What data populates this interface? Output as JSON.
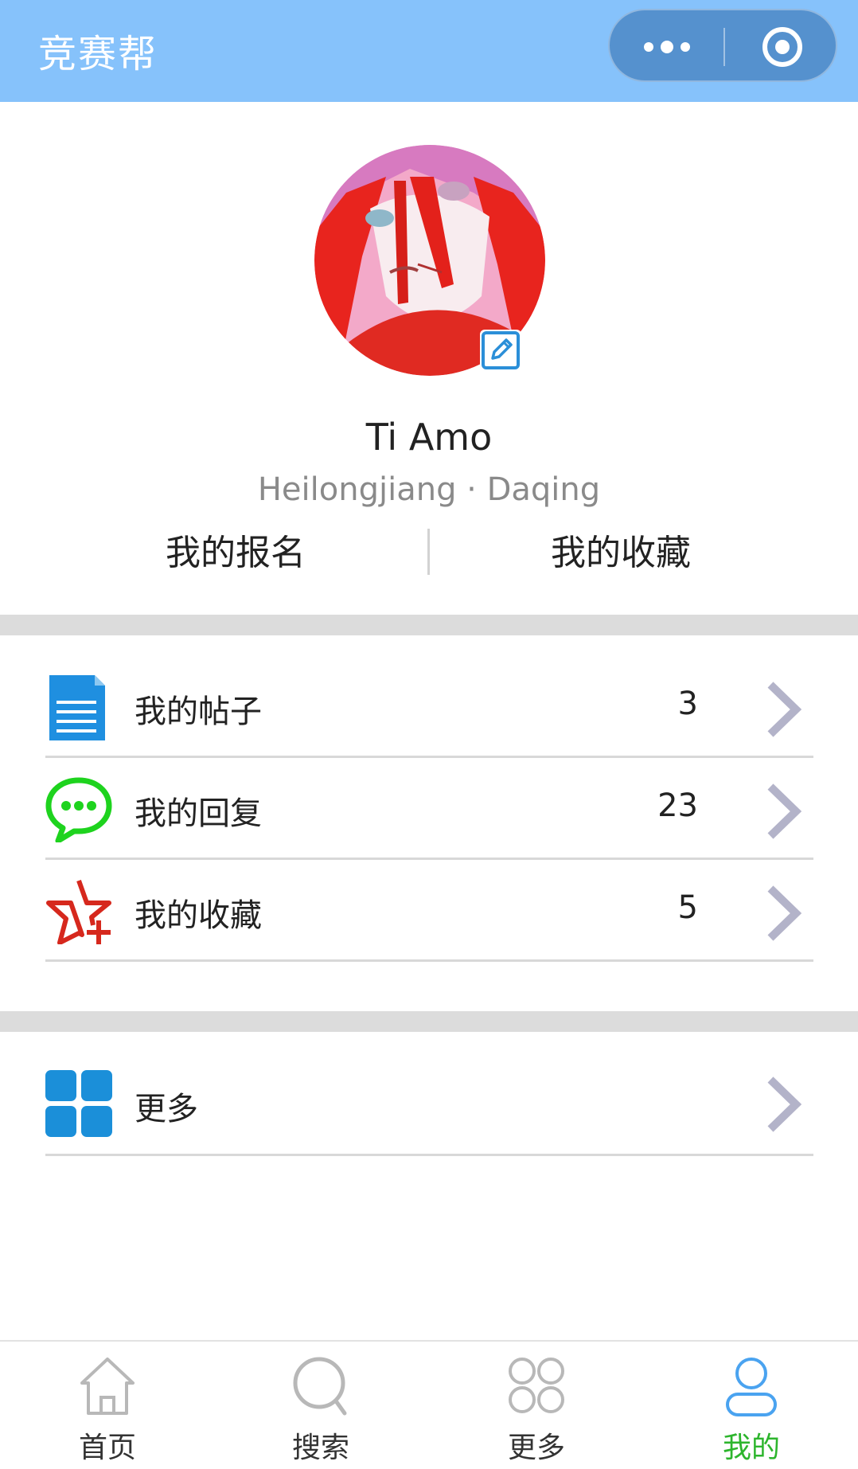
{
  "navbar": {
    "title": "竞赛帮",
    "menu_icon": "more-dots-icon",
    "close_icon": "target-circle-icon",
    "bg_color": "#86c2fb"
  },
  "profile": {
    "avatar_icon": "user-avatar-anime",
    "edit_icon": "edit-pencil-icon",
    "name": "Ti Amo",
    "location": "Heilongjiang · Daqing"
  },
  "quick_links": [
    {
      "label": "我的报名"
    },
    {
      "label": "我的收藏"
    }
  ],
  "menu_items": [
    {
      "label": "我的帖子",
      "count": "3",
      "icon": "document-icon"
    },
    {
      "label": "我的回复",
      "count": "23",
      "icon": "chat-bubble-icon"
    },
    {
      "label": "我的收藏",
      "count": "5",
      "icon": "star-plus-icon"
    }
  ],
  "more_item": {
    "label": "更多",
    "icon": "grid-icon"
  },
  "tabbar": {
    "active_color": "#2db52d",
    "items": [
      {
        "label": "首页",
        "icon": "home-icon"
      },
      {
        "label": "搜索",
        "icon": "search-icon"
      },
      {
        "label": "更多",
        "icon": "grid-icon"
      },
      {
        "label": "我的",
        "icon": "user-icon",
        "active": true
      }
    ]
  }
}
